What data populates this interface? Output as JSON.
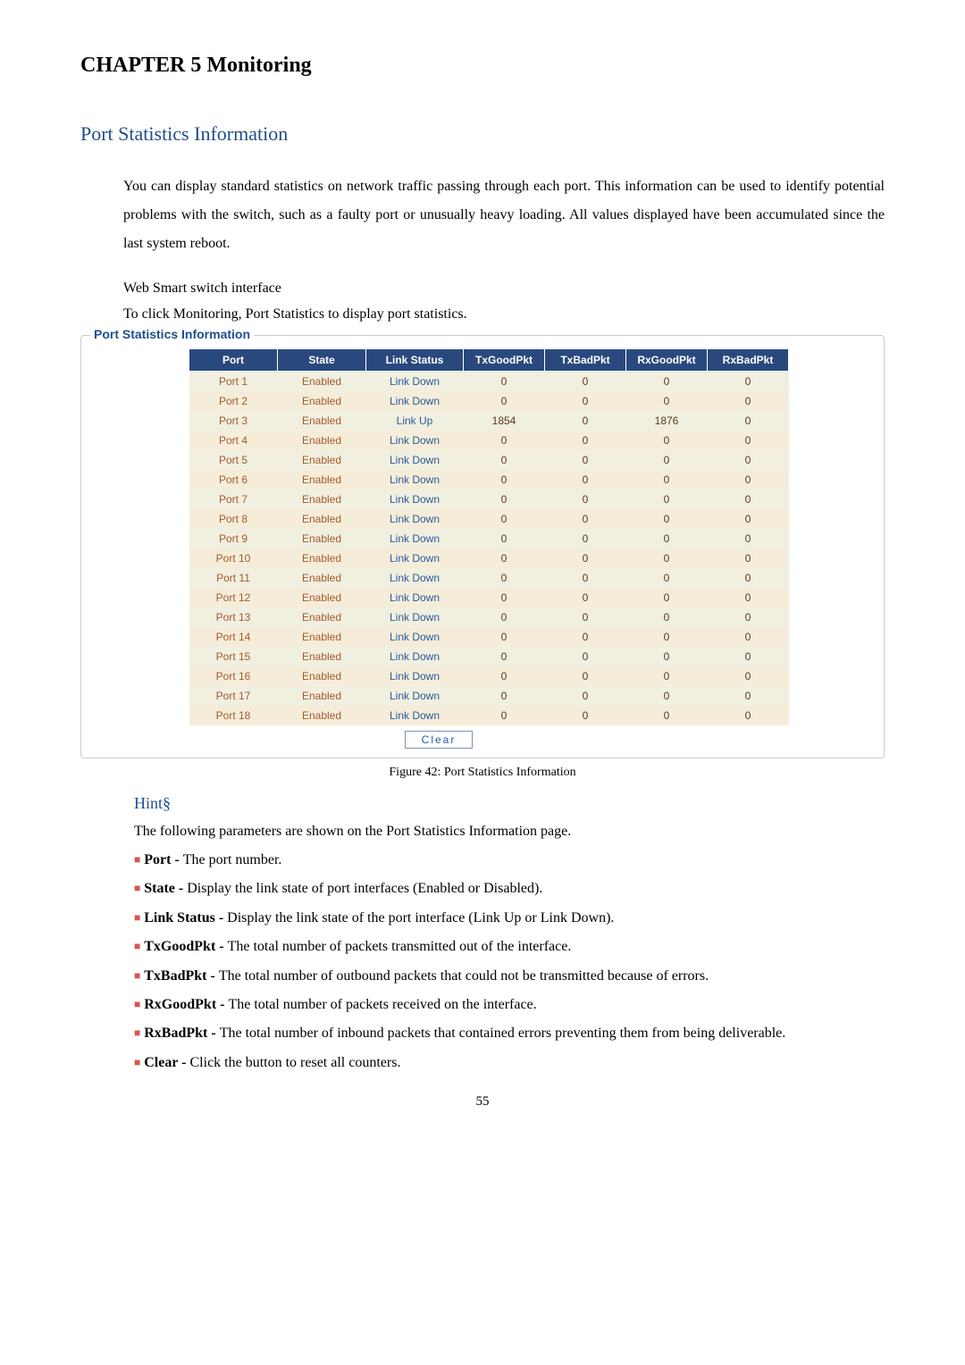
{
  "chapter_title": "CHAPTER 5    Monitoring",
  "section_title": "Port Statistics Information",
  "intro_paragraph": "You can display standard statistics on network traffic passing through each port. This information can be used to identify potential problems with the switch, such as a faulty port or unusually heavy loading. All values displayed have been accumulated since the last system reboot.",
  "sub1": "Web Smart switch interface",
  "sub2": "To click Monitoring, Port Statistics to display port statistics.",
  "legend": "Port Statistics Information",
  "table": {
    "headers": [
      "Port",
      "State",
      "Link Status",
      "TxGoodPkt",
      "TxBadPkt",
      "RxGoodPkt",
      "RxBadPkt"
    ],
    "rows": [
      [
        "Port 1",
        "Enabled",
        "Link Down",
        "0",
        "0",
        "0",
        "0"
      ],
      [
        "Port 2",
        "Enabled",
        "Link Down",
        "0",
        "0",
        "0",
        "0"
      ],
      [
        "Port 3",
        "Enabled",
        "Link Up",
        "1854",
        "0",
        "1876",
        "0"
      ],
      [
        "Port 4",
        "Enabled",
        "Link Down",
        "0",
        "0",
        "0",
        "0"
      ],
      [
        "Port 5",
        "Enabled",
        "Link Down",
        "0",
        "0",
        "0",
        "0"
      ],
      [
        "Port 6",
        "Enabled",
        "Link Down",
        "0",
        "0",
        "0",
        "0"
      ],
      [
        "Port 7",
        "Enabled",
        "Link Down",
        "0",
        "0",
        "0",
        "0"
      ],
      [
        "Port 8",
        "Enabled",
        "Link Down",
        "0",
        "0",
        "0",
        "0"
      ],
      [
        "Port 9",
        "Enabled",
        "Link Down",
        "0",
        "0",
        "0",
        "0"
      ],
      [
        "Port 10",
        "Enabled",
        "Link Down",
        "0",
        "0",
        "0",
        "0"
      ],
      [
        "Port 11",
        "Enabled",
        "Link Down",
        "0",
        "0",
        "0",
        "0"
      ],
      [
        "Port 12",
        "Enabled",
        "Link Down",
        "0",
        "0",
        "0",
        "0"
      ],
      [
        "Port 13",
        "Enabled",
        "Link Down",
        "0",
        "0",
        "0",
        "0"
      ],
      [
        "Port 14",
        "Enabled",
        "Link Down",
        "0",
        "0",
        "0",
        "0"
      ],
      [
        "Port 15",
        "Enabled",
        "Link Down",
        "0",
        "0",
        "0",
        "0"
      ],
      [
        "Port 16",
        "Enabled",
        "Link Down",
        "0",
        "0",
        "0",
        "0"
      ],
      [
        "Port 17",
        "Enabled",
        "Link Down",
        "0",
        "0",
        "0",
        "0"
      ],
      [
        "Port 18",
        "Enabled",
        "Link Down",
        "0",
        "0",
        "0",
        "0"
      ]
    ]
  },
  "clear_button": "Clear",
  "figure_caption": "Figure 42: Port Statistics Information",
  "hint_heading": "Hint§",
  "hint_intro": "The following parameters are shown on the Port Statistics Information page.",
  "bullets": [
    {
      "term": "Port - ",
      "desc": "The port number."
    },
    {
      "term": "State - ",
      "desc": "Display the link state of port interfaces (Enabled or Disabled)."
    },
    {
      "term": "Link Status - ",
      "desc": "Display the link state of the port interface (Link Up or Link Down)."
    },
    {
      "term": "TxGoodPkt - ",
      "desc": "The total number of packets transmitted out of the interface."
    },
    {
      "term": "TxBadPkt - ",
      "desc": "The total number of outbound packets that could not be transmitted because of errors."
    },
    {
      "term": "RxGoodPkt - ",
      "desc": "The total number of packets received on the interface."
    },
    {
      "term": "RxBadPkt - ",
      "desc": "The total number of inbound packets that contained errors preventing them from being deliverable."
    },
    {
      "term": "Clear - ",
      "desc": "Click the button to reset all counters."
    }
  ],
  "page_number": "55",
  "chart_data": {
    "type": "table",
    "title": "Port Statistics Information",
    "columns": [
      "Port",
      "State",
      "Link Status",
      "TxGoodPkt",
      "TxBadPkt",
      "RxGoodPkt",
      "RxBadPkt"
    ]
  }
}
